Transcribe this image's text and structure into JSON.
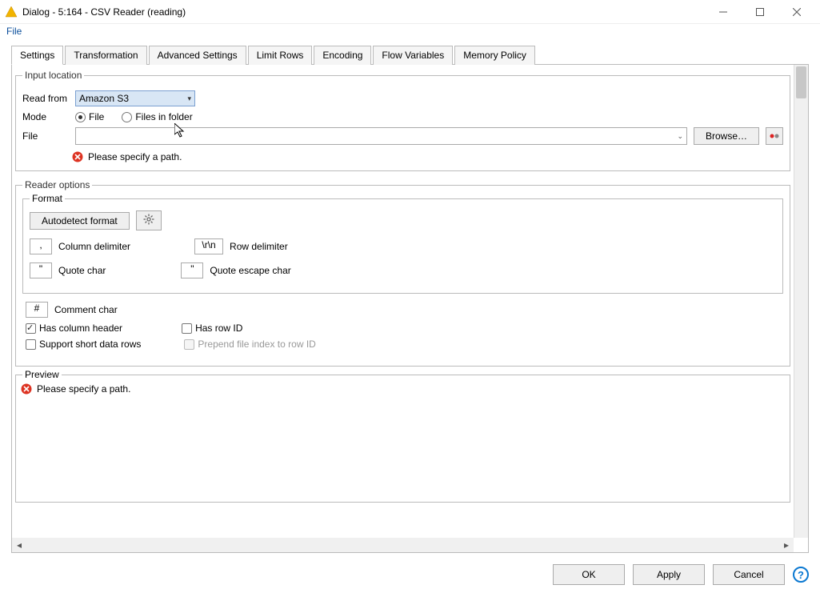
{
  "window": {
    "title": "Dialog - 5:164 - CSV Reader (reading)"
  },
  "menubar": {
    "file": "File"
  },
  "tabs": {
    "settings": "Settings",
    "transformation": "Transformation",
    "advanced": "Advanced Settings",
    "limit": "Limit Rows",
    "encoding": "Encoding",
    "flowvars": "Flow Variables",
    "memory": "Memory Policy"
  },
  "input_location": {
    "legend": "Input location",
    "read_from_label": "Read from",
    "read_from_value": "Amazon S3",
    "mode_label": "Mode",
    "mode_file": "File",
    "mode_folder": "Files in folder",
    "file_label": "File",
    "file_value": "",
    "browse": "Browse…",
    "error": "Please specify a path."
  },
  "reader_options": {
    "legend": "Reader options",
    "format_legend": "Format",
    "autodetect": "Autodetect format",
    "col_delim_label": "Column delimiter",
    "col_delim_value": ",",
    "row_delim_label": "Row delimiter",
    "row_delim_value": "\\r\\n",
    "quote_label": "Quote char",
    "quote_value": "\"",
    "quote_esc_label": "Quote escape char",
    "quote_esc_value": "\"",
    "comment_label": "Comment char",
    "comment_value": "#",
    "has_header": "Has column header",
    "has_rowid": "Has row ID",
    "support_short": "Support short data rows",
    "prepend_idx": "Prepend file index to row ID"
  },
  "preview": {
    "legend": "Preview",
    "error": "Please specify a path."
  },
  "footer": {
    "ok": "OK",
    "apply": "Apply",
    "cancel": "Cancel"
  }
}
